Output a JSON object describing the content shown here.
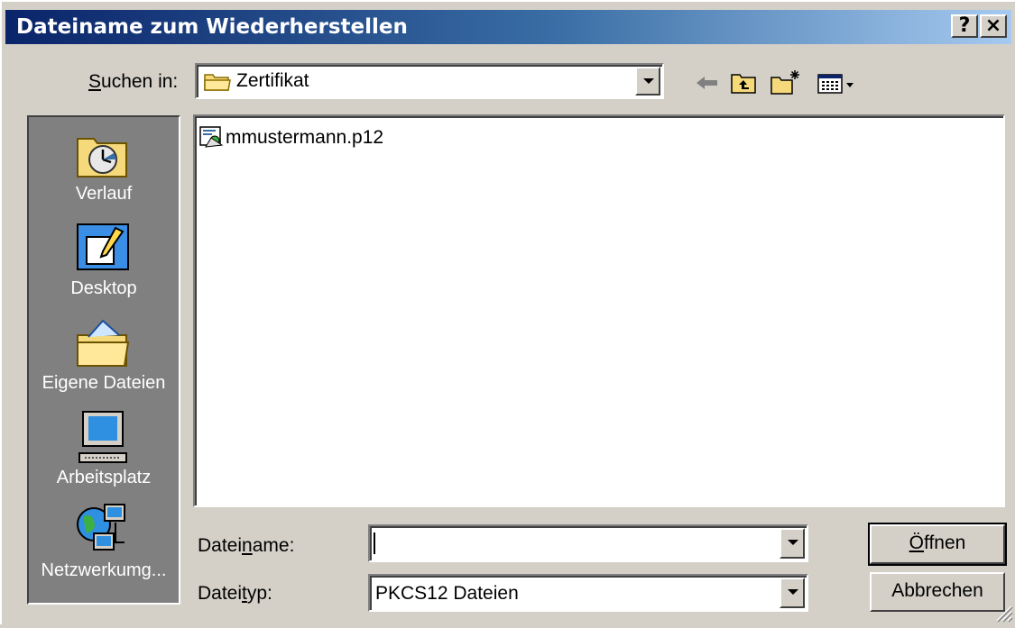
{
  "window": {
    "title": "Dateiname zum Wiederherstellen",
    "help_label": "?",
    "close_label": "×"
  },
  "lookin": {
    "label": "Suchen in:",
    "value": "Zertifikat"
  },
  "toolbar": {
    "icons": [
      "back-arrow-icon",
      "up-folder-icon",
      "new-folder-icon",
      "view-menu-icon"
    ]
  },
  "places": [
    {
      "label": "Verlauf",
      "icon": "history-icon"
    },
    {
      "label": "Desktop",
      "icon": "desktop-icon"
    },
    {
      "label": "Eigene Dateien",
      "icon": "my-documents-icon"
    },
    {
      "label": "Arbeitsplatz",
      "icon": "my-computer-icon"
    },
    {
      "label": "Netzwerkumg...",
      "icon": "network-icon"
    }
  ],
  "files": [
    {
      "name": "mmustermann.p12",
      "icon": "certificate-file-icon"
    }
  ],
  "filename": {
    "label": "Dateiname:",
    "value": ""
  },
  "filetype": {
    "label": "Dateityp:",
    "value": "PKCS12 Dateien"
  },
  "buttons": {
    "open": "Öffnen",
    "cancel": "Abbrechen"
  },
  "colors": {
    "title_start": "#0a246a",
    "title_end": "#a6caf0",
    "face": "#d4d0c8",
    "places_bg": "#808080"
  }
}
